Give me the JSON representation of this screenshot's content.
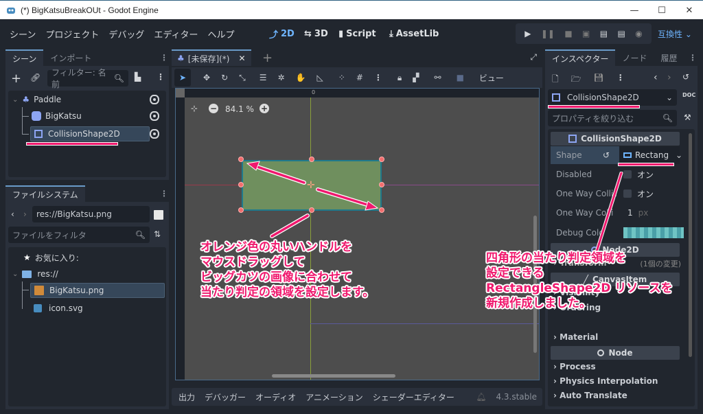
{
  "window": {
    "title": "(*) BigKatsuBreakOUt - Godot Engine",
    "minimize_label": "—",
    "maximize_label": "☐",
    "close_label": "✕"
  },
  "menubar": {
    "items": [
      "シーン",
      "プロジェクト",
      "デバッグ",
      "エディター",
      "ヘルプ"
    ],
    "workspaces": [
      {
        "label": "2D",
        "active": true
      },
      {
        "label": "3D",
        "active": false
      },
      {
        "label": "Script",
        "active": false
      },
      {
        "label": "AssetLib",
        "active": false
      }
    ],
    "renderer": "互換性"
  },
  "scene_dock": {
    "tabs": [
      "シーン",
      "インポート"
    ],
    "filter_placeholder": "フィルター: 名前",
    "nodes": [
      {
        "name": "Paddle",
        "icon": "character-body-icon",
        "level": 0
      },
      {
        "name": "BigKatsu",
        "icon": "sprite-icon",
        "level": 1
      },
      {
        "name": "CollisionShape2D",
        "icon": "collision-shape-icon",
        "level": 1,
        "selected": true
      }
    ]
  },
  "filesystem_dock": {
    "tab": "ファイルシステム",
    "path": "res://BigKatsu.png",
    "filter_placeholder": "ファイルをフィルタ",
    "favorites": "お気に入り:",
    "root": "res://",
    "files": [
      {
        "name": "BigKatsu.png",
        "selected": true
      },
      {
        "name": "icon.svg",
        "selected": false
      }
    ]
  },
  "editor": {
    "scene_tab": "[未保存](*)",
    "view_menu": "ビュー",
    "zoom": "84.1 %",
    "ruler_zero": "0"
  },
  "inspector": {
    "tabs": [
      "インスペクター",
      "ノード",
      "履歴"
    ],
    "object": "CollisionShape2D",
    "filter_placeholder": "プロパティを絞り込む",
    "section_title": "CollisionShape2D",
    "properties": [
      {
        "label": "Shape",
        "value": "Rectang"
      },
      {
        "label": "Disabled",
        "value": "オン"
      },
      {
        "label": "One Way Collis",
        "value": "オン"
      },
      {
        "label": "One Way Colli",
        "value": "1",
        "unit": "px"
      },
      {
        "label": "Debug Colo",
        "value": ""
      }
    ],
    "node2d_section": "Node2D",
    "transform_group": "Transform",
    "transform_note": "(1個の変更)",
    "canvasitem_section": "CanvasItem",
    "canvasitem_groups": [
      "Visibility",
      "Ordering",
      "Material"
    ],
    "node_section": "Node",
    "node_groups": [
      "Process",
      "Physics Interpolation",
      "Auto Translate"
    ]
  },
  "bottom_panel": {
    "tabs": [
      "出力",
      "デバッガー",
      "オーディオ",
      "アニメーション",
      "シェーダーエディター"
    ],
    "version": "4.3.stable"
  },
  "annotations": {
    "left_note": [
      "オレンジ色の丸いハンドルを",
      "マウスドラッグして",
      "ビッグカツの画像に合わせて",
      "当たり判定の領域を設定します。"
    ],
    "right_note": [
      "四角形の当たり判定領域を",
      "設定できる",
      "RectangleShape2D リソースを",
      "新規作成しました。"
    ],
    "accent_color": "#f0196e"
  }
}
